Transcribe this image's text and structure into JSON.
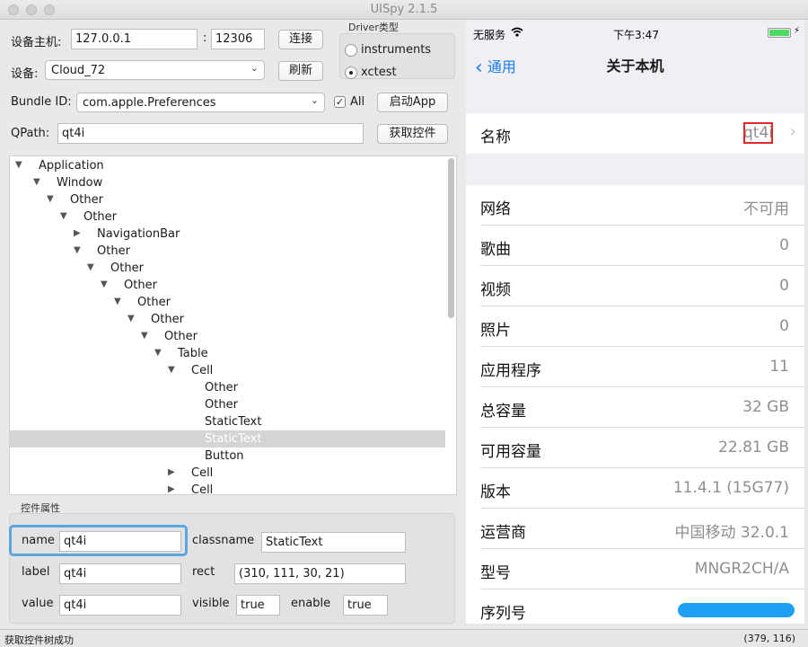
{
  "window": {
    "title": "UISpy 2.1.5"
  },
  "connection": {
    "host_label": "设备主机:",
    "host_value": "127.0.0.1",
    "port_separator": ":",
    "port_value": "12306",
    "connect_button": "连接",
    "device_label": "设备:",
    "device_value": "Cloud_72",
    "refresh_button": "刷新",
    "bundle_label": "Bundle ID:",
    "bundle_value": "com.apple.Preferences",
    "all_checkbox_label": "All",
    "all_checked": true,
    "launch_button": "启动App",
    "qpath_label": "QPath:",
    "qpath_value": "qt4i",
    "get_controls_button": "获取控件"
  },
  "driver": {
    "group_title": "Driver类型",
    "options": [
      "instruments",
      "xctest"
    ],
    "selected": "xctest"
  },
  "tree": {
    "rows": [
      {
        "label": "Application",
        "arrow": "▼"
      },
      {
        "label": "Window",
        "arrow": "▼"
      },
      {
        "label": "Other",
        "arrow": "▼"
      },
      {
        "label": "Other",
        "arrow": "▼"
      },
      {
        "label": "NavigationBar",
        "arrow": "▶"
      },
      {
        "label": "Other",
        "arrow": "▼"
      },
      {
        "label": "Other",
        "arrow": "▼"
      },
      {
        "label": "Other",
        "arrow": "▼"
      },
      {
        "label": "Other",
        "arrow": "▼"
      },
      {
        "label": "Other",
        "arrow": "▼"
      },
      {
        "label": "Other",
        "arrow": "▼"
      },
      {
        "label": "Table",
        "arrow": "▼"
      },
      {
        "label": "Cell",
        "arrow": "▼"
      },
      {
        "label": "Other",
        "arrow": ""
      },
      {
        "label": "Other",
        "arrow": ""
      },
      {
        "label": "StaticText",
        "arrow": ""
      },
      {
        "label": "StaticText",
        "arrow": "",
        "selected": true
      },
      {
        "label": "Button",
        "arrow": ""
      },
      {
        "label": "Cell",
        "arrow": "▶"
      },
      {
        "label": "Cell",
        "arrow": "▶"
      }
    ]
  },
  "properties": {
    "group_title": "控件属性",
    "name_label": "name",
    "name_value": "qt4i",
    "classname_label": "classname",
    "classname_value": "StaticText",
    "label_label": "label",
    "label_value": "qt4i",
    "rect_label": "rect",
    "rect_value": "(310, 111, 30, 21)",
    "value_label": "value",
    "value_value": "qt4i",
    "visible_label": "visible",
    "visible_value": "true",
    "enable_label": "enable",
    "enable_value": "true"
  },
  "status": {
    "message": "获取控件树成功",
    "coords": "(379, 116)"
  },
  "phone": {
    "carrier": "无服务",
    "time": "下午3:47",
    "back_label": "通用",
    "nav_title": "关于本机",
    "name_row": {
      "label": "名称",
      "value": "qt4i"
    },
    "rows": [
      {
        "label": "网络",
        "value": "不可用"
      },
      {
        "label": "歌曲",
        "value": "0"
      },
      {
        "label": "视频",
        "value": "0"
      },
      {
        "label": "照片",
        "value": "0"
      },
      {
        "label": "应用程序",
        "value": "11"
      },
      {
        "label": "总容量",
        "value": "32 GB"
      },
      {
        "label": "可用容量",
        "value": "22.81 GB"
      },
      {
        "label": "版本",
        "value": "11.4.1 (15G77)"
      },
      {
        "label": "运营商",
        "value": "中国移动 32.0.1"
      },
      {
        "label": "型号",
        "value": "MNGR2CH/A"
      },
      {
        "label": "序列号",
        "value": ""
      }
    ],
    "colors": {
      "accent": "#1a7cf2",
      "highlight": "#e02828",
      "battery": "#4cd964"
    }
  }
}
